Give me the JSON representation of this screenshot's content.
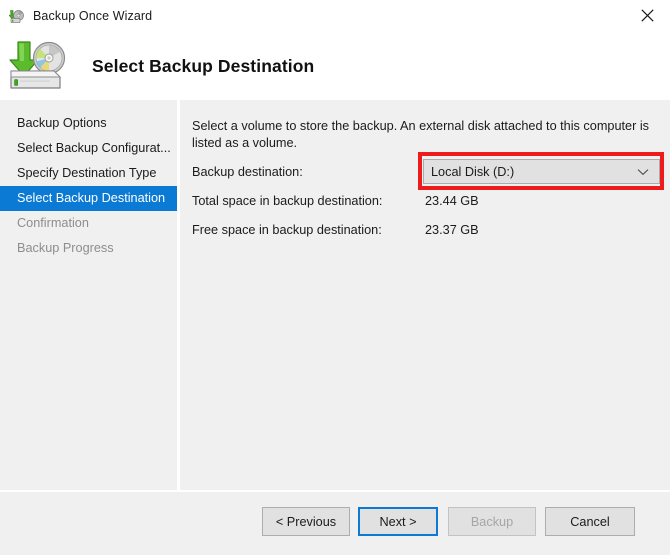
{
  "window": {
    "title": "Backup Once Wizard",
    "title_icon": "backup-disk-icon",
    "close_icon": "close-icon"
  },
  "header": {
    "title": "Select Backup Destination",
    "icon": "backup-destination-disk-icon"
  },
  "sidebar": {
    "items": [
      {
        "label": "Backup Options",
        "state": "normal"
      },
      {
        "label": "Select Backup Configurat...",
        "state": "normal"
      },
      {
        "label": "Specify Destination Type",
        "state": "normal"
      },
      {
        "label": "Select Backup Destination",
        "state": "active"
      },
      {
        "label": "Confirmation",
        "state": "disabled"
      },
      {
        "label": "Backup Progress",
        "state": "disabled"
      }
    ]
  },
  "content": {
    "intro": "Select a volume to store the backup. An external disk attached to this computer is listed as a volume.",
    "destination_label": "Backup destination:",
    "destination_value": "Local Disk (D:)",
    "destination_options": [
      "Local Disk (D:)"
    ],
    "dropdown_icon": "chevron-down-icon",
    "total_space_label": "Total space in backup destination:",
    "total_space_value": "23.44 GB",
    "free_space_label": "Free space in backup destination:",
    "free_space_value": "23.37 GB"
  },
  "annotation": {
    "name": "highlight-rectangle",
    "color": "#ee1b1b"
  },
  "footer": {
    "previous_label": "< Previous",
    "next_label": "Next >",
    "backup_label": "Backup",
    "cancel_label": "Cancel"
  },
  "colors": {
    "accent": "#0a7ad4",
    "surface": "#f0f0f0",
    "titlebar": "#ffffff",
    "disabled_text": "#8d8d8d"
  }
}
